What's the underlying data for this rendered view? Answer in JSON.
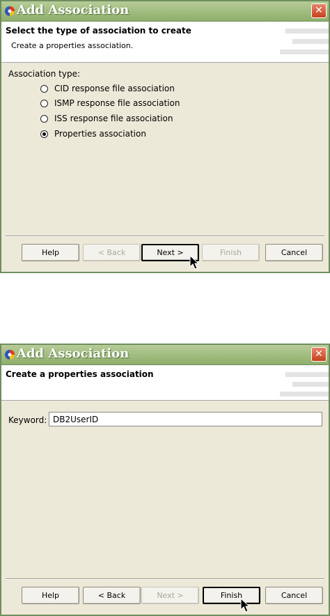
{
  "dialog1": {
    "title": "Add Association",
    "close_label": "✕",
    "header_title": "Select the type of association to create",
    "header_subtitle": "Create a properties association.",
    "section_label": "Association type:",
    "options": [
      {
        "label": "CID response file association",
        "selected": false
      },
      {
        "label": "ISMP response file association",
        "selected": false
      },
      {
        "label": "ISS response file association",
        "selected": false
      },
      {
        "label": "Properties association",
        "selected": true
      }
    ],
    "buttons": {
      "help": "Help",
      "back": "< Back",
      "next": "Next >",
      "finish": "Finish",
      "cancel": "Cancel"
    }
  },
  "dialog2": {
    "title": "Add Association",
    "close_label": "✕",
    "header_title": "Create a properties association",
    "keyword_label": "Keyword:",
    "keyword_value": "DB2UserID",
    "buttons": {
      "help": "Help",
      "back": "< Back",
      "next": "Next >",
      "finish": "Finish",
      "cancel": "Cancel"
    }
  },
  "colors": {
    "title_bar": "#8fae6b",
    "dialog_bg": "#ece9d8",
    "close_button": "#c6411c"
  }
}
